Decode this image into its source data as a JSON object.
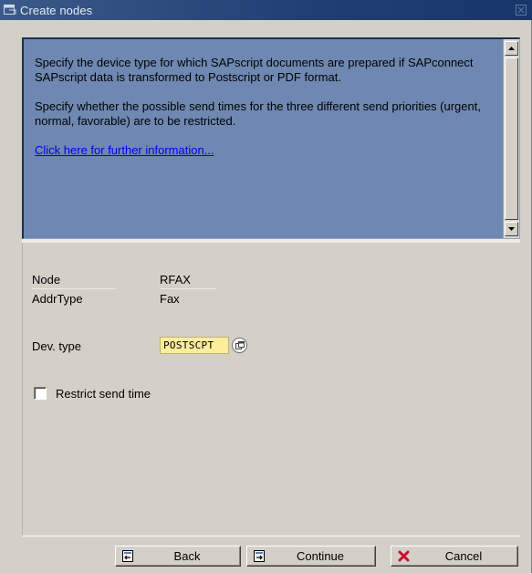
{
  "window": {
    "title": "Create nodes"
  },
  "info": {
    "paragraph1": "Specify the device type for which SAPscript documents are prepared if SAPconnect SAPscript data is transformed to Postscript or PDF format.",
    "paragraph2": "Specify whether the possible send times for the three different send priorities (urgent, normal, favorable) are to be restricted.",
    "link": "Click here for further information..."
  },
  "form": {
    "node_label": "Node",
    "node_value": "RFAX",
    "addrtype_label": "AddrType",
    "addrtype_value": "Fax",
    "devtype_label": "Dev. type",
    "devtype_value": "POSTSCPT",
    "restrict_label": "Restrict send time",
    "restrict_checked": false
  },
  "buttons": {
    "back": "Back",
    "continue": "Continue",
    "cancel": "Cancel"
  },
  "colors": {
    "titlebar": "#1f3f73",
    "info_background": "#6e88b2",
    "input_highlight": "#ffed9e",
    "link": "#0000ee",
    "cancel_icon": "#c8102e"
  },
  "icons": {
    "title": "window-icon",
    "close": "close-icon",
    "f4": "value-help-icon",
    "back": "back-icon",
    "continue": "continue-icon",
    "cancel": "cancel-x-icon"
  }
}
